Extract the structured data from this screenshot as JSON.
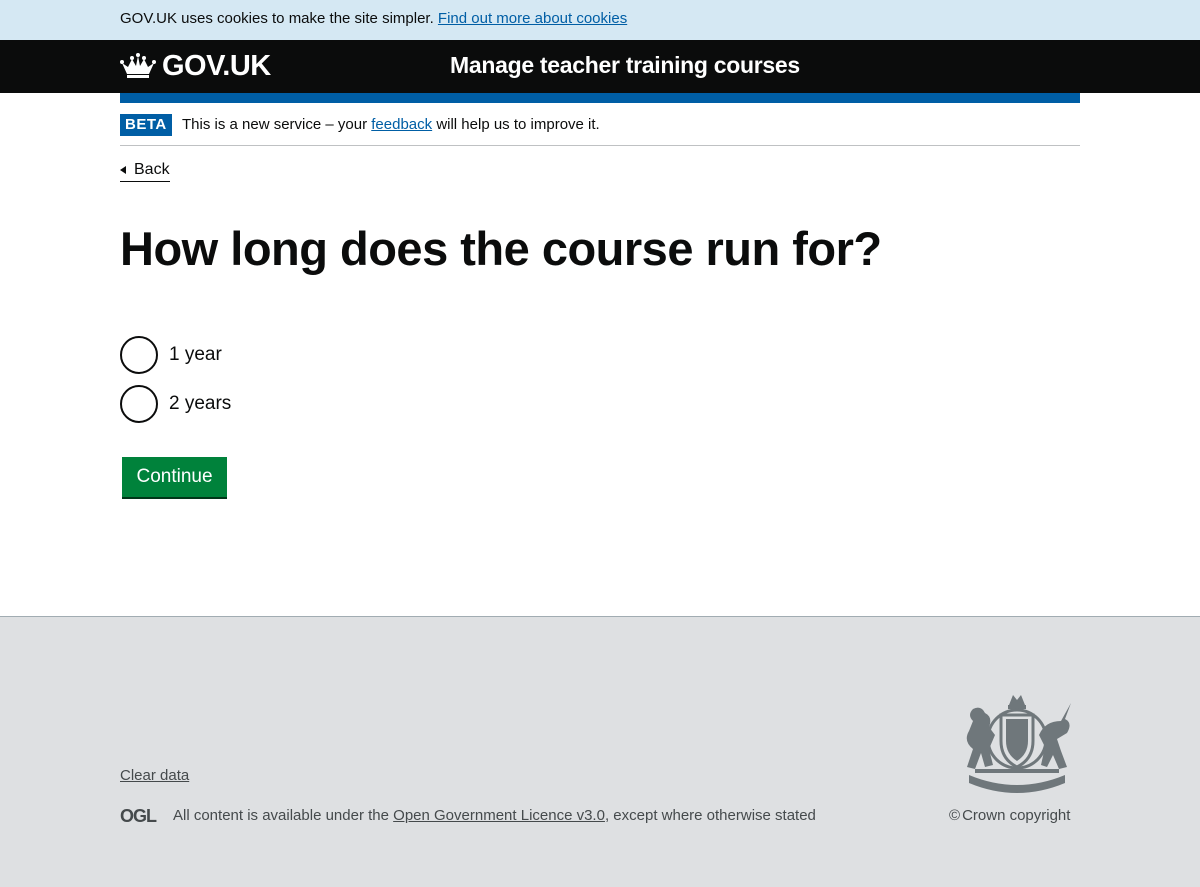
{
  "cookie_banner": {
    "text": "GOV.UK uses cookies to make the site simpler.",
    "link": "Find out more about cookies"
  },
  "header": {
    "logo_text": "GOV.UK",
    "logo_icon": "crown-icon",
    "service_name": "Manage teacher training courses"
  },
  "phase_banner": {
    "tag": "BETA",
    "text_before": "This is a new service – your",
    "link": "feedback",
    "text_after": "will help us to improve it."
  },
  "back_link": "Back",
  "page_title": "How long does the course run for?",
  "options": [
    {
      "label": "1 year",
      "selected": false
    },
    {
      "label": "2 years",
      "selected": false
    }
  ],
  "continue_label": "Continue",
  "footer": {
    "clear_data": "Clear data",
    "ogl_logo_text": "OGL",
    "licence_before": "All content is available under the",
    "licence_link": "Open Government Licence v3.0",
    "licence_after": ", except where otherwise stated",
    "crest_icon": "royal-coat-of-arms-icon",
    "copyright_symbol": "©",
    "copyright": "Crown copyright"
  },
  "colors": {
    "header_bg": "#0b0c0c",
    "brand_blue": "#005ea5",
    "cookie_bg": "#d5e8f3",
    "button_green": "#00823b",
    "footer_bg": "#dee0e2"
  }
}
